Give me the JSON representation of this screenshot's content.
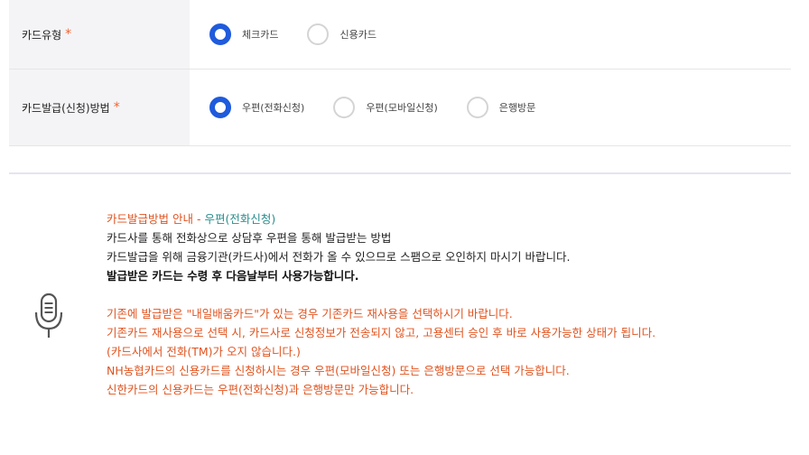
{
  "form": {
    "card_type": {
      "label": "카드유형",
      "required_mark": "*",
      "options": [
        "체크카드",
        "신용카드"
      ],
      "selected_index": 0
    },
    "issue_method": {
      "label": "카드발급(신청)방법",
      "required_mark": "*",
      "options": [
        "우편(전화신청)",
        "우편(모바일신청)",
        "은행방문"
      ],
      "selected_index": 0
    }
  },
  "notice": {
    "icon": "microphone-icon",
    "title_prefix": "카드발급방법 안내 - ",
    "title_method": "우편(전화신청)",
    "lines": [
      "카드사를 통해 전화상으로 상담후 우편을 통해 발급받는 방법",
      "카드발급을 위해 금융기관(카드사)에서 전화가 올 수 있으므로 스팸으로 오인하지 마시기 바랍니다."
    ],
    "bold_line": "발급받은 카드는 수령 후 다음날부터 사용가능합니다.",
    "orange_lines": [
      "기존에 발급받은 \"내일배움카드\"가 있는 경우 기존카드 재사용을 선택하시기 바랍니다.",
      "기존카드 재사용으로 선택 시, 카드사로 신청정보가 전송되지 않고, 고용센터 승인 후 바로 사용가능한 상태가 됩니다.",
      "(카드사에서 전화(TM)가 오지 않습니다.)",
      "NH농협카드의 신용카드를 신청하시는 경우 우편(모바일신청) 또는 은행방문으로 선택 가능합니다.",
      "신한카드의 신용카드는 우편(전화신청)과 은행방문만 가능합니다."
    ]
  },
  "colors": {
    "accent_blue": "#1f5bdc",
    "required_orange": "#f2622e",
    "notice_orange": "#e0531f",
    "notice_teal": "#2a8d8d",
    "label_bg": "#f4f4f6"
  }
}
